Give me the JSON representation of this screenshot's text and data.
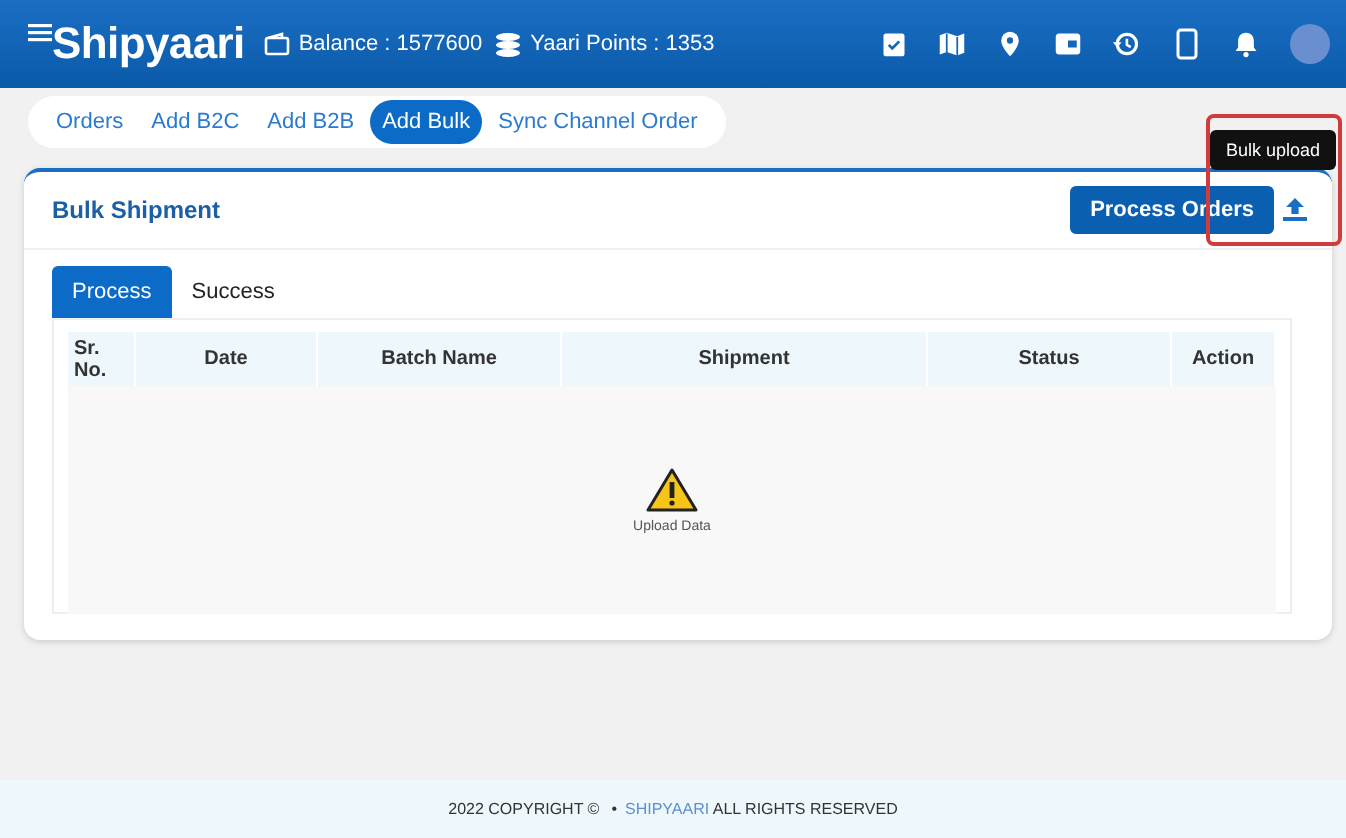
{
  "header": {
    "logo": "Shipyaari",
    "balance": "Balance : 1577600",
    "points": "Yaari Points : 1353"
  },
  "nav_tabs": [
    {
      "label": "Orders",
      "selected": false
    },
    {
      "label": "Add B2C",
      "selected": false
    },
    {
      "label": "Add B2B",
      "selected": false
    },
    {
      "label": "Add Bulk",
      "selected": true
    },
    {
      "label": "Sync Channel Order",
      "selected": false
    }
  ],
  "card": {
    "title": "Bulk Shipment",
    "process_button": "Process Orders",
    "tooltip": "Bulk upload",
    "tabs": [
      {
        "label": "Process",
        "selected": true
      },
      {
        "label": "Success",
        "selected": false
      }
    ],
    "table": {
      "columns": [
        "Sr. No.",
        "Date",
        "Batch Name",
        "Shipment",
        "Status",
        "Action"
      ],
      "empty_message": "Upload Data"
    }
  },
  "footer": {
    "copyright": "2022 COPYRIGHT ©",
    "separator": "•",
    "brand": "SHIPYAARI",
    "rights": "ALL RIGHTS RESERVED"
  }
}
